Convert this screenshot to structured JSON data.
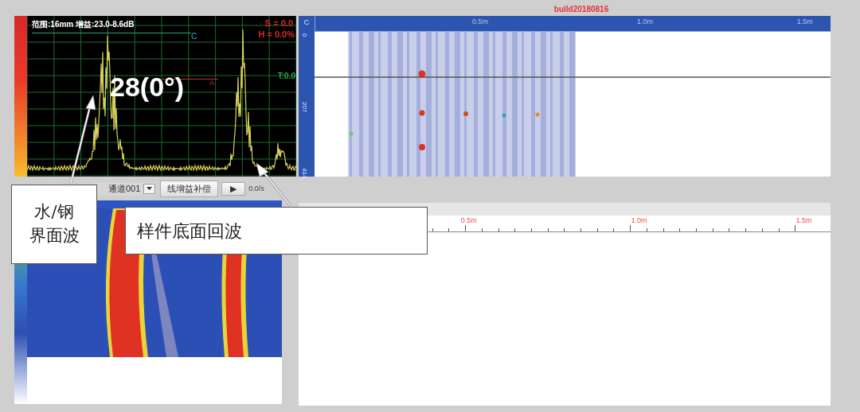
{
  "build": "build20180816",
  "ascan": {
    "range_gain": "范围:16mm 增益:23.0-8.6dB",
    "s_value": "S = 0.0",
    "h_value": "H = 0.0%",
    "t_value": "T:0.0",
    "gate_c": "C",
    "gate_a": "A",
    "reading": "28(0°)"
  },
  "controls": {
    "channel": "通道001",
    "gain_button": "线增益补偿",
    "play_button": "▶",
    "speed": "0.0/s"
  },
  "cscan": {
    "corner": "C",
    "xticks": [
      "0.5m",
      "1.0m",
      "1.5m"
    ],
    "yticks": [
      "0",
      "207",
      "414"
    ]
  },
  "ruler": {
    "xticks": [
      "0.5m",
      "1.0m",
      "1.5m"
    ]
  },
  "callouts": [
    {
      "text": "水/钢界面波"
    },
    {
      "text": "样件底面回波"
    }
  ]
}
